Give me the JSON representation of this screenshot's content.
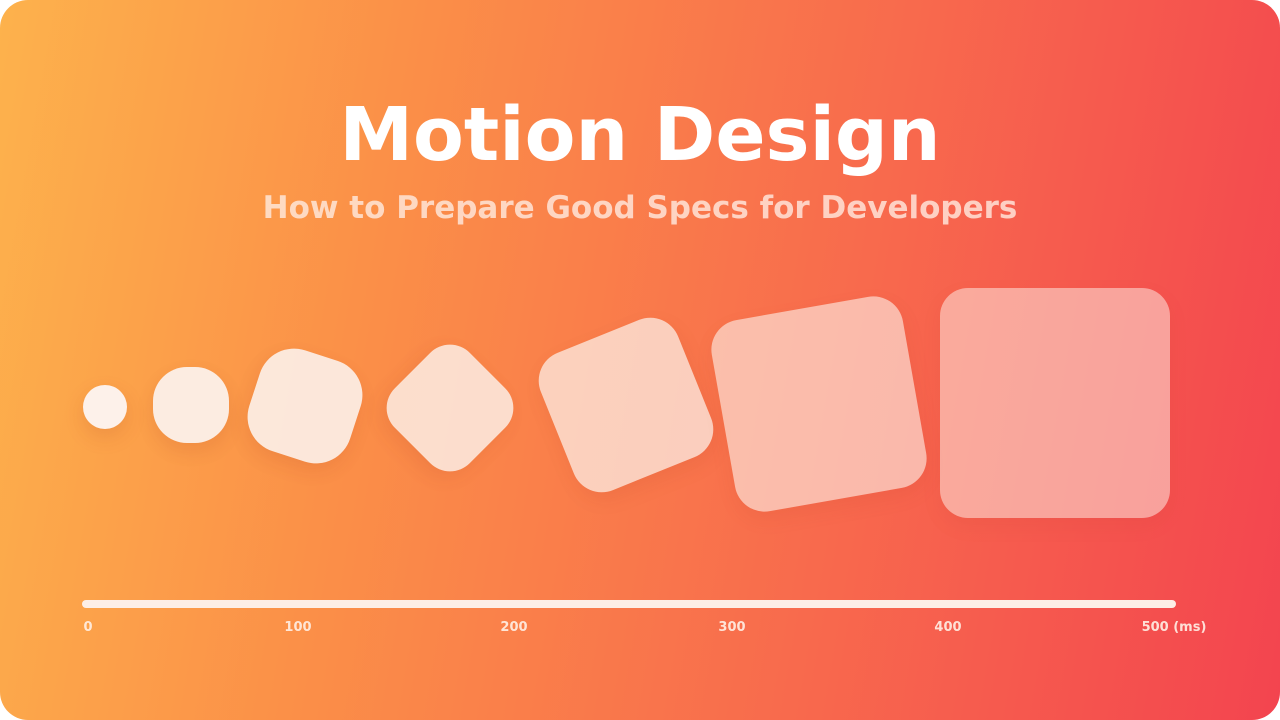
{
  "title": "Motion Design",
  "subtitle": "How to Prepare Good Specs for Developers",
  "timeline": {
    "labels": [
      "0",
      "100",
      "200",
      "300",
      "400",
      "500 (ms)"
    ]
  },
  "colors": {
    "gradient_start": "#fdb24c",
    "gradient_end": "#f3444f",
    "shape": "#fdf1ea"
  }
}
